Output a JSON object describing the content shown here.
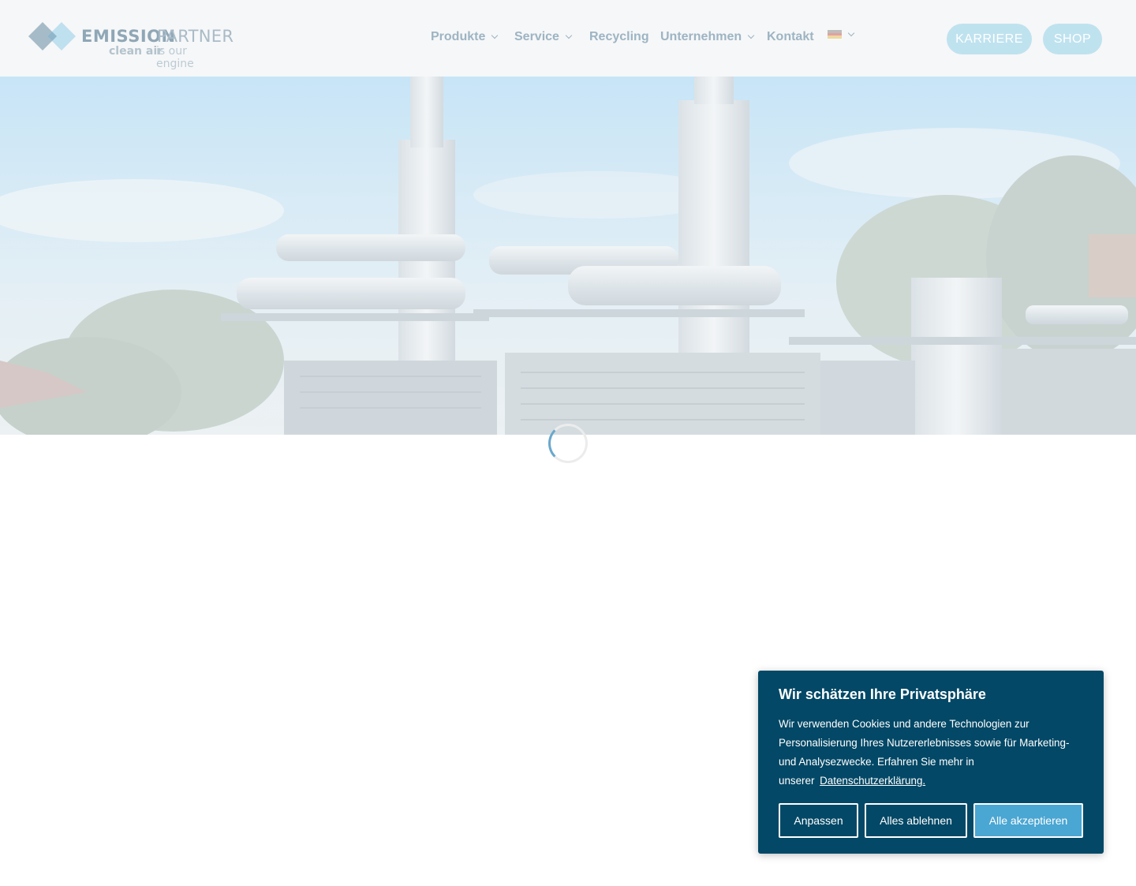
{
  "header": {
    "logo": {
      "word_bold": "EMISSION",
      "word_light": "PARTNER",
      "tagline_bold": "clean air",
      "tagline_light": "is our engine"
    },
    "nav": [
      {
        "label": "Produkte",
        "has_dropdown": true
      },
      {
        "label": "Service",
        "has_dropdown": true
      },
      {
        "label": "Recycling",
        "has_dropdown": false
      },
      {
        "label": "Unternehmen",
        "has_dropdown": true
      },
      {
        "label": "Kontakt",
        "has_dropdown": false
      }
    ],
    "language": {
      "icon": "german-flag-icon",
      "has_dropdown": true
    },
    "buttons": {
      "career": "KARRIERE",
      "shop": "SHOP"
    }
  },
  "hero": {
    "image": "industrial-emission-plant-photo"
  },
  "loading": {
    "icon": "loading-spinner-icon"
  },
  "cookie_banner": {
    "title": "Wir schätzen Ihre Privatsphäre",
    "text_line1": "Wir verwenden Cookies und andere Technologien zur",
    "text_line2": "Personalisierung Ihres Nutzererlebnisses sowie für Marketing-",
    "text_line3": "und Analysezwecke. Erfahren Sie mehr in",
    "text_line4": "unserer",
    "link": "Datenschutzerklärung.",
    "buttons": {
      "customize": "Anpassen",
      "reject": "Alles ablehnen",
      "accept": "Alle akzeptieren"
    }
  },
  "colors": {
    "header_bg": "#f6f7f8",
    "nav_text": "#9db4c3",
    "pill_button": "#bfe2ef",
    "cookie_bg": "#034866",
    "accept_button": "#4aa6d2"
  }
}
